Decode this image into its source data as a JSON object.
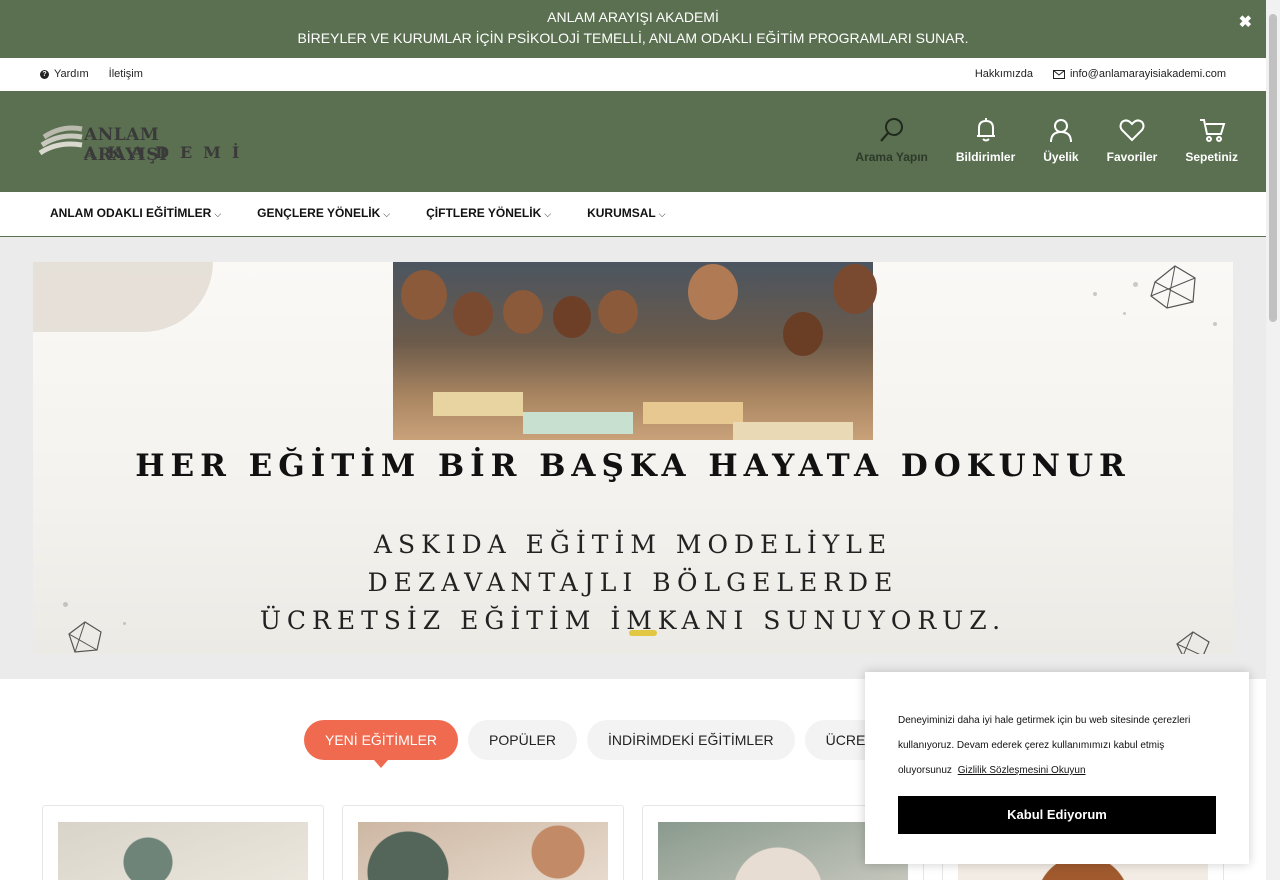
{
  "announce": {
    "line1": "ANLAM ARAYIŞI AKADEMİ",
    "line2": "BİREYLER VE KURUMLAR İÇİN PSİKOLOJİ TEMELLİ, ANLAM ODAKLI EĞİTİM PROGRAMLARI SUNAR.",
    "close": "✖"
  },
  "util": {
    "help": "Yardım",
    "contact": "İletişim",
    "about": "Hakkımızda",
    "email": "info@anlamarayisiakademi.com"
  },
  "logo": {
    "line1": "ANLAM ARAYIŞI",
    "line2": "AKADEMİ"
  },
  "header_icons": [
    {
      "label": "Arama Yapın",
      "icon": "search-icon"
    },
    {
      "label": "Bildirimler",
      "icon": "bell-icon"
    },
    {
      "label": "Üyelik",
      "icon": "user-icon"
    },
    {
      "label": "Favoriler",
      "icon": "heart-icon"
    },
    {
      "label": "Sepetiniz",
      "icon": "cart-icon"
    }
  ],
  "nav": [
    {
      "label": "ANLAM ODAKLI EĞİTİMLER"
    },
    {
      "label": "GENÇLERE YÖNELİK"
    },
    {
      "label": "ÇİFTLERE YÖNELİK"
    },
    {
      "label": "KURUMSAL"
    }
  ],
  "hero": {
    "title": "HER EĞİTİM BİR BAŞKA HAYATA DOKUNUR",
    "sub1": "ASKIDA EĞİTİM MODELİYLE",
    "sub2": "DEZAVANTAJLI BÖLGELERDE",
    "sub3": "ÜCRETSİZ EĞİTİM İMKANI SUNUYORUZ."
  },
  "tabs": [
    {
      "label": "YENİ EĞİTİMLER",
      "active": true
    },
    {
      "label": "POPÜLER"
    },
    {
      "label": "İNDİRİMDEKİ EĞİTİMLER"
    },
    {
      "label": "ÜCRETSİZ"
    }
  ],
  "cookie": {
    "text": "Deneyiminizi daha iyi hale getirmek için bu web sitesinde çerezleri kullanıyoruz. Devam ederek çerez kullanımımızı kabul etmiş oluyorsunuz",
    "link": "Gizlilik Sözleşmesini Okuyun",
    "button": "Kabul Ediyorum"
  },
  "colors": {
    "brand": "#5a7050",
    "accent": "#f06a4f",
    "slider_dot": "#e2c742"
  }
}
